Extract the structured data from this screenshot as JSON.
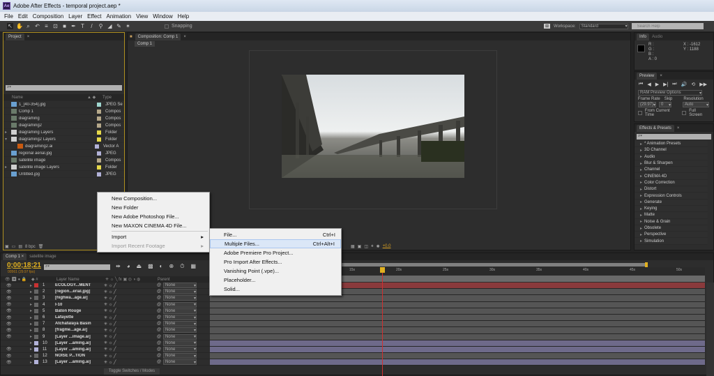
{
  "window": {
    "title": "Adobe After Effects - temporal project.aep *",
    "app_icon": "Ae"
  },
  "menubar": [
    "File",
    "Edit",
    "Composition",
    "Layer",
    "Effect",
    "Animation",
    "View",
    "Window",
    "Help"
  ],
  "toolbar": {
    "snapping": "Snapping",
    "workspace_label": "Workspace:",
    "workspace_value": "Standard",
    "search_placeholder": "Search Help"
  },
  "project": {
    "tab": "Project",
    "col_name": "Name",
    "col_type": "Type",
    "bpc": "8 bpc",
    "items": [
      {
        "name": "1_[40-354].jpg",
        "type": "JPEG Se",
        "color": "#9fd7d0",
        "icon": "image-sequence-icon",
        "expander": ""
      },
      {
        "name": "Comp 1",
        "type": "Compos",
        "color": "#b5a88a",
        "icon": "composition-icon",
        "expander": ""
      },
      {
        "name": "diagraming",
        "type": "Compos",
        "color": "#b5a88a",
        "icon": "composition-icon",
        "expander": ""
      },
      {
        "name": "diagraming2",
        "type": "Compos",
        "color": "#b5a88a",
        "icon": "composition-icon",
        "expander": ""
      },
      {
        "name": "diagraming Layers",
        "type": "Folder",
        "color": "#e6d94a",
        "icon": "folder-icon",
        "expander": "▸"
      },
      {
        "name": "diagraming2 Layers",
        "type": "Folder",
        "color": "#e6d94a",
        "icon": "folder-icon",
        "expander": "▾"
      },
      {
        "name": "diagraming2.ai",
        "type": "Vector A",
        "color": "#b2b2d8",
        "icon": "illustrator-file-icon",
        "expander": "",
        "indent": true
      },
      {
        "name": "regional aerial.jpg",
        "type": "JPEG",
        "color": "#b2b2d8",
        "icon": "image-icon",
        "expander": ""
      },
      {
        "name": "satellite image",
        "type": "Compos",
        "color": "#b5a88a",
        "icon": "composition-icon",
        "expander": ""
      },
      {
        "name": "satellite image Layers",
        "type": "Folder",
        "color": "#e6d94a",
        "icon": "folder-icon",
        "expander": "▸"
      },
      {
        "name": "Untitled.jpg",
        "type": "JPEG",
        "color": "#b2b2d8",
        "icon": "image-icon",
        "expander": ""
      }
    ]
  },
  "composition": {
    "tab": "Composition: Comp 1",
    "subtab": "Comp 1",
    "exposure": "+0.0"
  },
  "info": {
    "tab": "Info",
    "tab2": "Audio",
    "r": "R :",
    "g": "G :",
    "b": "B :",
    "a": "A : 0",
    "x": "X : -1612",
    "y": "Y : 1188"
  },
  "preview": {
    "tab": "Preview",
    "ram": "RAM Preview Options",
    "frame_rate_label": "Frame Rate",
    "skip_label": "Skip",
    "resolution_label": "Resolution",
    "frame_rate": "(29.97)",
    "skip": "0",
    "resolution": "Auto",
    "from_current": "From Current Time",
    "full_screen": "Full Screen"
  },
  "effects": {
    "tab": "Effects & Presets",
    "items": [
      "* Animation Presets",
      "3D Channel",
      "Audio",
      "Blur & Sharpen",
      "Channel",
      "CINEMA 4D",
      "Color Correction",
      "Distort",
      "Expression Controls",
      "Generate",
      "Keying",
      "Matte",
      "Noise & Grain",
      "Obsolete",
      "Perspective",
      "Simulation"
    ]
  },
  "context_menu": {
    "items": [
      {
        "label": "New Composition...",
        "disabled": false
      },
      {
        "label": "New Folder",
        "disabled": false
      },
      {
        "label": "New Adobe Photoshop File...",
        "disabled": false
      },
      {
        "label": "New MAXON CINEMA 4D File...",
        "disabled": false
      },
      {
        "label": "Import",
        "disabled": false,
        "submenu": true
      },
      {
        "label": "Import Recent Footage",
        "disabled": true,
        "submenu": true
      }
    ]
  },
  "import_submenu": [
    {
      "label": "File...",
      "shortcut": "Ctrl+I"
    },
    {
      "label": "Multiple Files...",
      "shortcut": "Ctrl+Alt+I"
    },
    {
      "label": "Adobe Premiere Pro Project...",
      "shortcut": ""
    },
    {
      "label": "Pro Import After Effects...",
      "shortcut": ""
    },
    {
      "label": "Vanishing Point (.vpe)...",
      "shortcut": ""
    },
    {
      "label": "Placeholder...",
      "shortcut": ""
    },
    {
      "label": "Solid...",
      "shortcut": ""
    }
  ],
  "timeline": {
    "tab1": "Comp 1",
    "tab2": "satellite image",
    "timecode": "0;00;18;21",
    "frames": "00561 (29.97 fps)",
    "col_layer": "Layer Name",
    "col_parent": "Parent",
    "toggle": "Toggle Switches / Modes",
    "ruler": [
      "15s",
      "20s",
      "25s",
      "30s",
      "35s",
      "40s",
      "45s",
      "50s"
    ],
    "playhead_fraction": 0.35,
    "layers": [
      {
        "num": "1",
        "name": "ECOLOGY...MENT",
        "label": "#c83232",
        "bar": "#8a3a3c",
        "parent": "None"
      },
      {
        "num": "2",
        "name": "[region...erial.jpg]",
        "label": "#666",
        "bar": "#555",
        "parent": "None"
      },
      {
        "num": "3",
        "name": "[highwa...age.ai]",
        "label": "#666",
        "bar": "#555",
        "parent": "None"
      },
      {
        "num": "4",
        "name": "I-10",
        "label": "#666",
        "bar": "#555",
        "parent": "None"
      },
      {
        "num": "5",
        "name": "Baton Rouge",
        "label": "#666",
        "bar": "#555",
        "parent": "None"
      },
      {
        "num": "6",
        "name": "Lafayette",
        "label": "#666",
        "bar": "#555",
        "parent": "None"
      },
      {
        "num": "7",
        "name": "Atchafalaya Basin",
        "label": "#666",
        "bar": "#555",
        "parent": "None"
      },
      {
        "num": "8",
        "name": "[fragme...age.ai]",
        "label": "#666",
        "bar": "#555",
        "parent": "None"
      },
      {
        "num": "9",
        "name": "[Layer ...image.ai]",
        "label": "#666",
        "bar": "#555",
        "parent": "None"
      },
      {
        "num": "10",
        "name": "[Layer ...aming.ai]",
        "label": "#b2b2d8",
        "bar": "#6e6a8a",
        "parent": "None"
      },
      {
        "num": "11",
        "name": "[Layer ...aming.ai]",
        "label": "#b2b2d8",
        "bar": "#6e6a8a",
        "parent": "None"
      },
      {
        "num": "12",
        "name": "NOISE P...TION",
        "label": "#666",
        "bar": "#555",
        "parent": "None"
      },
      {
        "num": "13",
        "name": "[Layer ...aming.ai]",
        "label": "#b2b2d8",
        "bar": "#6e6a8a",
        "parent": "None"
      }
    ]
  }
}
